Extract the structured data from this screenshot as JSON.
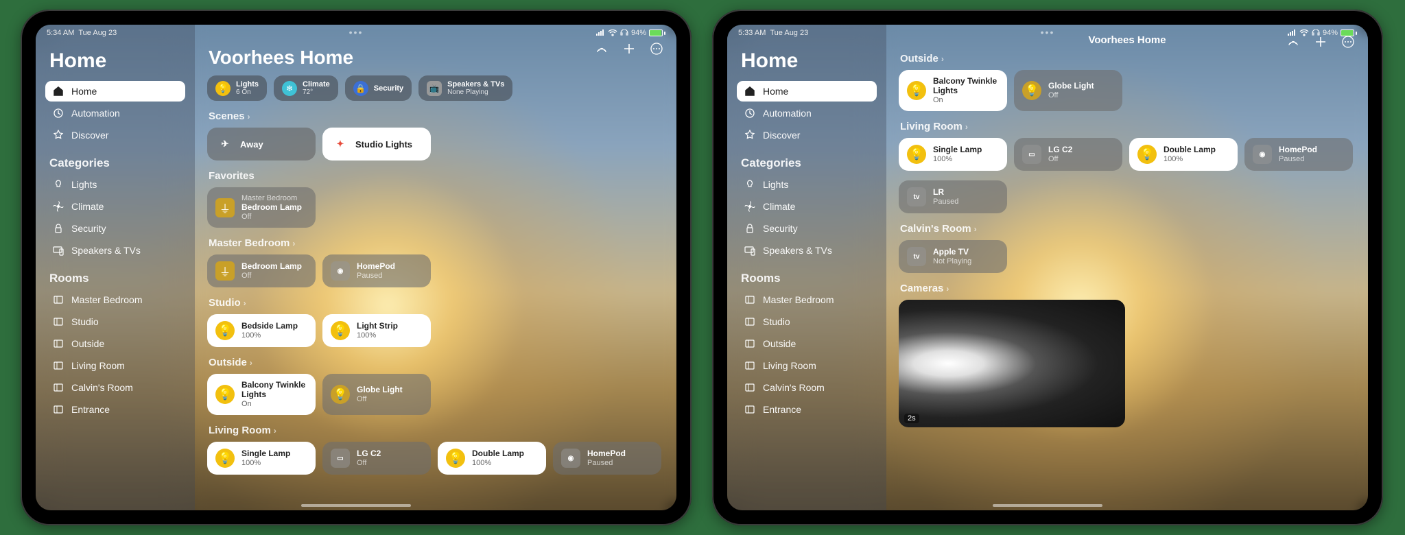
{
  "status": {
    "time_a": "5:34 AM",
    "time_b": "5:33 AM",
    "date": "Tue Aug 23",
    "battery": "94%"
  },
  "sidebar": {
    "title": "Home",
    "nav": [
      "Home",
      "Automation",
      "Discover"
    ],
    "cat_label": "Categories",
    "categories": [
      "Lights",
      "Climate",
      "Security",
      "Speakers & TVs"
    ],
    "rooms_label": "Rooms",
    "rooms": [
      "Master Bedroom",
      "Studio",
      "Outside",
      "Living Room",
      "Calvin's Room",
      "Entrance"
    ]
  },
  "hdr": {
    "home_name": "Voorhees Home"
  },
  "pills": {
    "lights": {
      "t": "Lights",
      "s": "6 On"
    },
    "climate": {
      "t": "Climate",
      "s": "72°"
    },
    "security": {
      "t": "Security"
    },
    "speakers": {
      "t": "Speakers & TVs",
      "s": "None Playing"
    }
  },
  "scenes": {
    "label": "Scenes",
    "away": "Away",
    "studio": "Studio Lights"
  },
  "favorites": {
    "label": "Favorites",
    "item": {
      "room": "Master Bedroom",
      "name": "Bedroom Lamp",
      "state": "Off"
    }
  },
  "master": {
    "label": "Master Bedroom",
    "lamp": {
      "name": "Bedroom Lamp",
      "state": "Off"
    },
    "pod": {
      "name": "HomePod",
      "state": "Paused"
    }
  },
  "studio": {
    "label": "Studio",
    "bedside": {
      "name": "Bedside Lamp",
      "state": "100%"
    },
    "strip": {
      "name": "Light Strip",
      "state": "100%"
    }
  },
  "outside": {
    "label": "Outside",
    "twinkle": {
      "name": "Balcony Twinkle Lights",
      "state": "On"
    },
    "globe": {
      "name": "Globe Light",
      "state": "Off"
    }
  },
  "living": {
    "label": "Living Room",
    "single": {
      "name": "Single Lamp",
      "state": "100%"
    },
    "lg": {
      "name": "LG C2",
      "state": "Off"
    },
    "double": {
      "name": "Double Lamp",
      "state": "100%"
    },
    "pod": {
      "name": "HomePod",
      "state": "Paused"
    },
    "lr": {
      "name": "LR",
      "state": "Paused"
    }
  },
  "calvin": {
    "label": "Calvin's Room",
    "atv": {
      "name": "Apple TV",
      "state": "Not Playing"
    }
  },
  "cameras": {
    "label": "Cameras",
    "ts": "2s"
  }
}
